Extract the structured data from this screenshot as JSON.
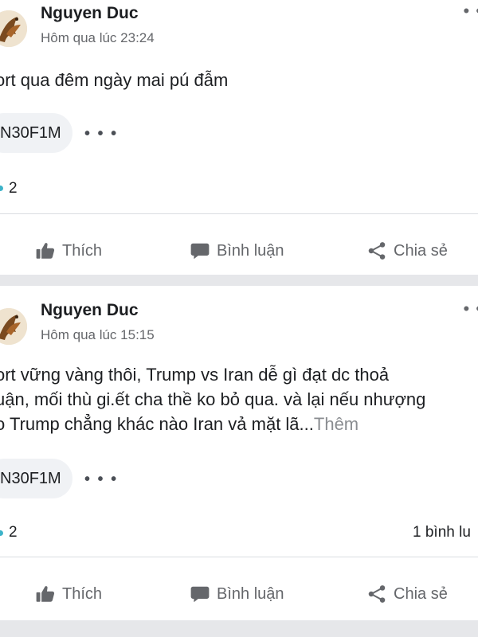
{
  "posts": [
    {
      "author": "Nguyen Duc",
      "timestamp": "Hôm qua lúc 23:24",
      "text_lines": [
        "ort qua đêm ngày mai pú đẫm"
      ],
      "see_more": "",
      "tag": "N30F1M",
      "reaction_count": "2",
      "comment_count": ""
    },
    {
      "author": "Nguyen Duc",
      "timestamp": "Hôm qua lúc 15:15",
      "text_lines": [
        "ort vững vàng thôi, Trump vs Iran dễ gì đạt dc thoả",
        "uận, mối thù gi.ết cha thề ko bỏ qua. và lại nếu nhượng",
        "o Trump chẳng khác nào Iran vả mặt lã..."
      ],
      "see_more": "Thêm",
      "tag": "N30F1M",
      "reaction_count": "2",
      "comment_count": "1 bình lu"
    }
  ],
  "actions": {
    "like_label": "Thích",
    "comment_label": "Bình luận",
    "share_label": "Chia sẻ"
  },
  "icons": {
    "like": "thumbs-up-icon",
    "comment": "speech-bubble-icon",
    "share": "share-icon",
    "more": "more-dots-icon"
  },
  "colors": {
    "secondary_text": "#65676b",
    "reaction_dot": "#3db3c9",
    "chip_bg": "#f0f2f5",
    "section_band": "#e6e7ea"
  }
}
